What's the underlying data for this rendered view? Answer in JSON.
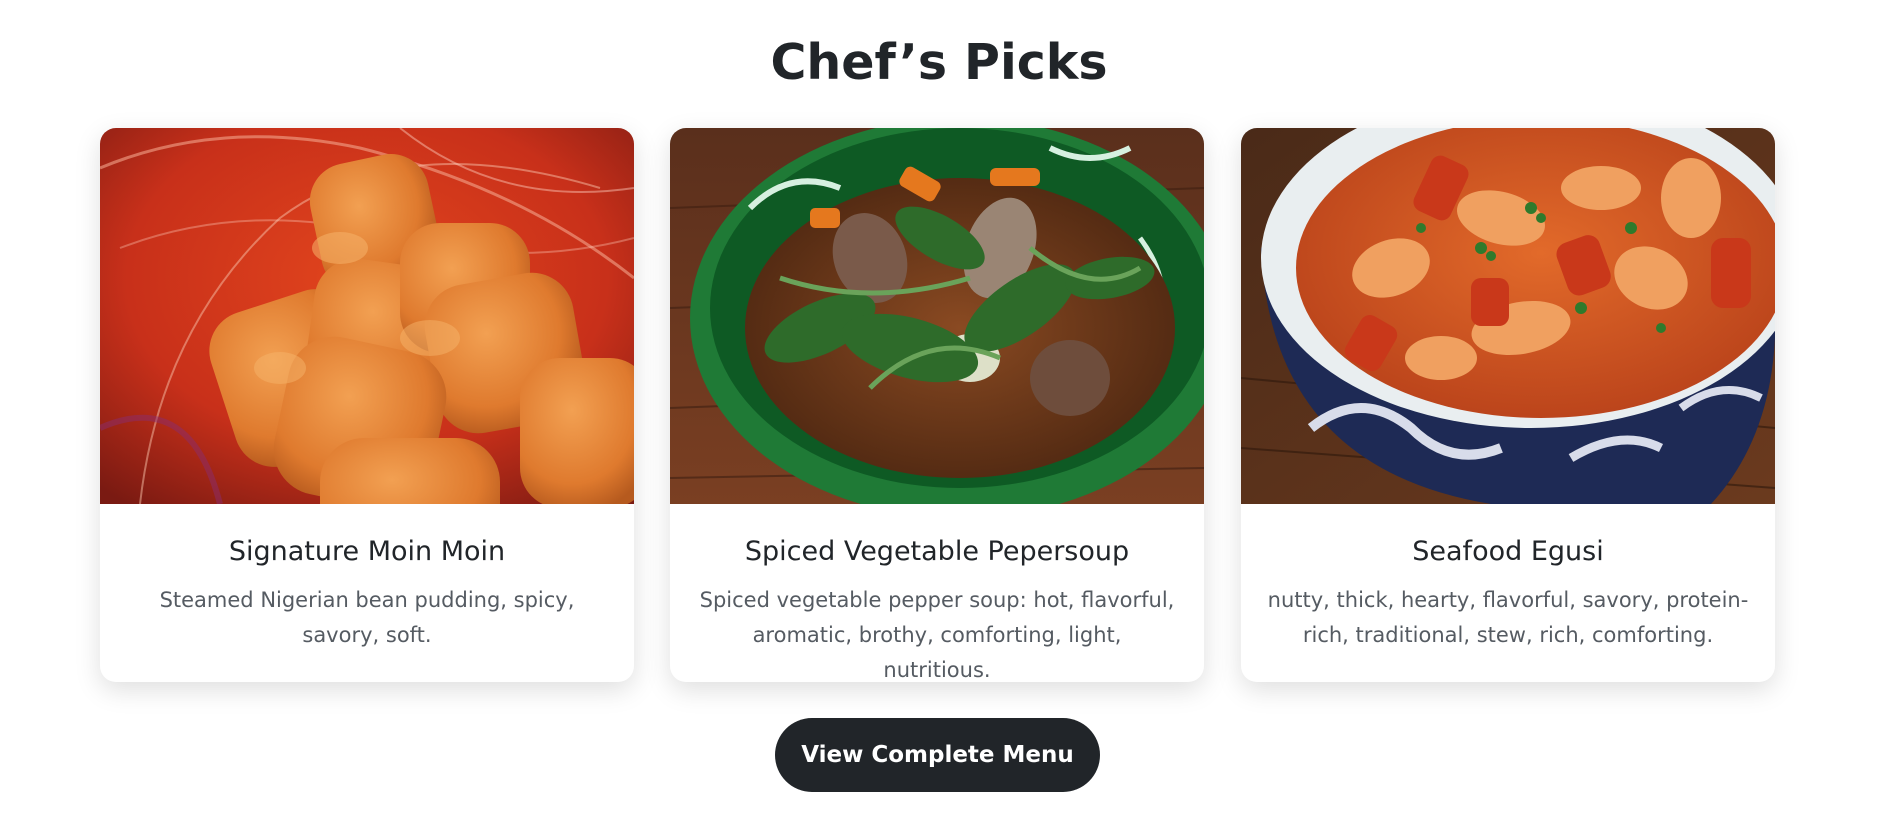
{
  "section": {
    "title": "Chef’s Picks"
  },
  "cards": [
    {
      "image": "moin-moin-photo",
      "title": "Signature Moin Moin",
      "description": "Steamed Nigerian bean pudding, spicy, savory, soft."
    },
    {
      "image": "pepper-soup-photo",
      "title": "Spiced Vegetable Pepersoup",
      "description": "Spiced vegetable pepper soup: hot, flavorful, aromatic, brothy, comforting, light, nutritious."
    },
    {
      "image": "seafood-egusi-photo",
      "title": "Seafood Egusi",
      "description": "nutty, thick, hearty, flavorful, savory, protein-rich, traditional, stew, rich, comforting."
    }
  ],
  "cta": {
    "label": "View Complete Menu"
  },
  "colors": {
    "text": "#212529",
    "muted": "#555b62",
    "button_bg": "#212529",
    "button_text": "#ffffff"
  }
}
